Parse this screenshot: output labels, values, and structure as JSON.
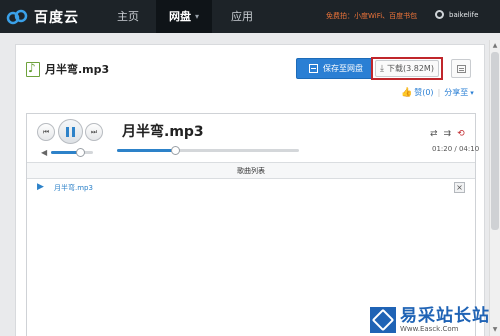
{
  "topbar": {
    "brand": "百度云",
    "nav": [
      {
        "label": "主页"
      },
      {
        "label": "网盘"
      },
      {
        "label": "应用"
      }
    ],
    "promo": "免费拍：小度WiFi、百度书包",
    "username": "baikelife"
  },
  "file": {
    "name": "月半弯.mp3",
    "save_label": "保存至网盘",
    "download_label": "下载(3.82M)",
    "like_label": "赞(0)",
    "share_label": "分享至"
  },
  "player": {
    "track_title": "月半弯.mp3",
    "time": "01:20 / 04:10",
    "volume": 0.7,
    "progress": 0.32,
    "playlist_header": "歌曲列表",
    "playlist": [
      {
        "name": "月半弯.mp3"
      }
    ],
    "icons": {
      "prev": "prev-icon",
      "pause": "pause-icon",
      "next": "next-icon",
      "shuffle": "shuffle-icon",
      "order": "order-icon",
      "loop": "loop-icon"
    }
  },
  "colors": {
    "topbar": "#1d2328",
    "accent": "#2a7fd4",
    "promo": "#f0753a",
    "highlight": "#c0262b"
  },
  "watermark": {
    "title": "易采站长站",
    "url": "Www.Easck.Com"
  }
}
